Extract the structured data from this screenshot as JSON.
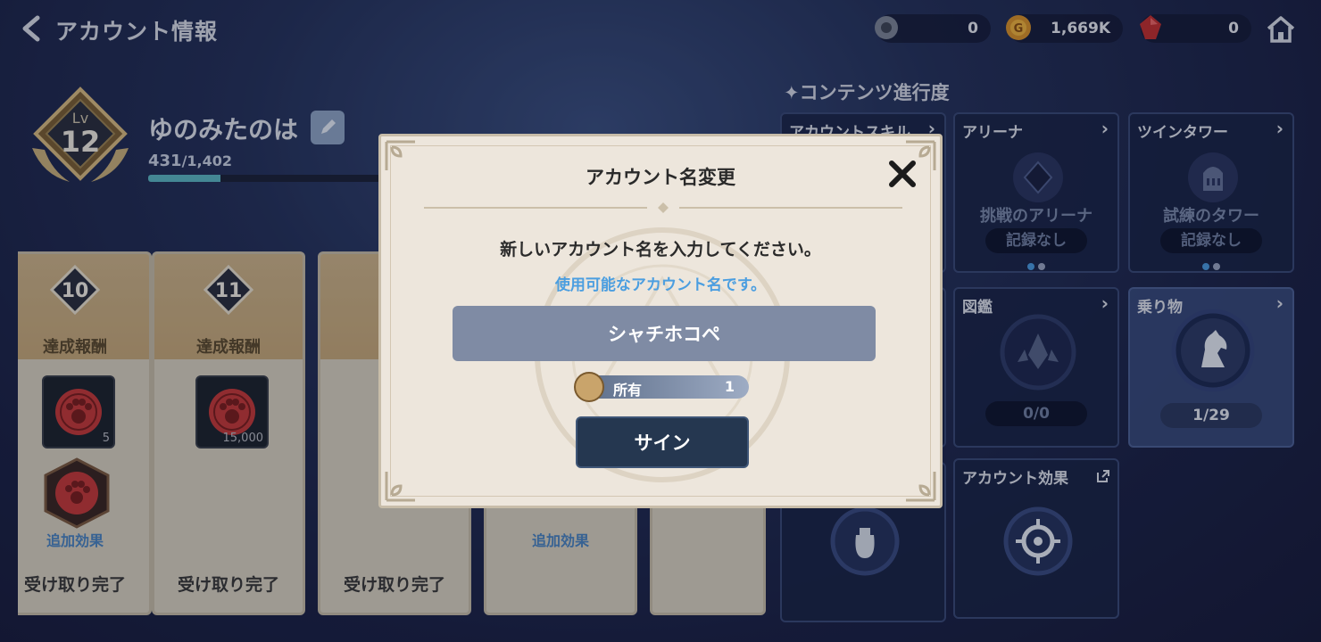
{
  "header": {
    "title": "アカウント情報",
    "currencies": [
      {
        "icon": "gear-token-icon",
        "value": "0"
      },
      {
        "icon": "gold-coin-icon",
        "value": "1,669K"
      },
      {
        "icon": "red-gem-icon",
        "value": "0"
      }
    ]
  },
  "profile": {
    "level_label": "Lv",
    "level": "12",
    "name": "ゆのみたのは",
    "exp_current": "431",
    "exp_max": "/1,402",
    "exp_progress": 0.31
  },
  "rewards": [
    {
      "level": "10",
      "label": "達成報酬",
      "item_count": "5",
      "bonus": "追加効果",
      "status": "受け取り完了"
    },
    {
      "level": "11",
      "label": "達成報酬",
      "item_count": "15,000",
      "bonus": "",
      "status": "受け取り完了"
    },
    {
      "level": "",
      "label": "達",
      "item_count": "",
      "bonus": "",
      "status": "受け取り完了"
    },
    {
      "level": "",
      "label": "",
      "item_count": "",
      "bonus": "追加効果",
      "status": ""
    }
  ],
  "content": {
    "title": "✦コンテンツ進行度",
    "tiles": {
      "skill": {
        "title": "アカウントスキル"
      },
      "arena": {
        "title": "アリーナ",
        "sub": "挑戦のアリーナ",
        "record": "記録なし"
      },
      "tower": {
        "title": "ツインタワー",
        "sub": "試練のタワー",
        "record": "記録なし"
      },
      "codex": {
        "title": "図鑑",
        "count": "0/0"
      },
      "ride": {
        "title": "乗り物",
        "count": "1/29"
      },
      "effect": {
        "title": "アカウント効果"
      }
    }
  },
  "modal": {
    "title": "アカウント名変更",
    "prompt": "新しいアカウント名を入力してください。",
    "status": "使用可能なアカウント名です。",
    "input_value": "シャチホコペ",
    "owned_label": "所有",
    "owned_count": "1",
    "button_label": "サイン"
  },
  "colors": {
    "accent_blue": "#4b9ee0",
    "button_dark": "#253750",
    "exp_fill": "#5cb8c4"
  }
}
